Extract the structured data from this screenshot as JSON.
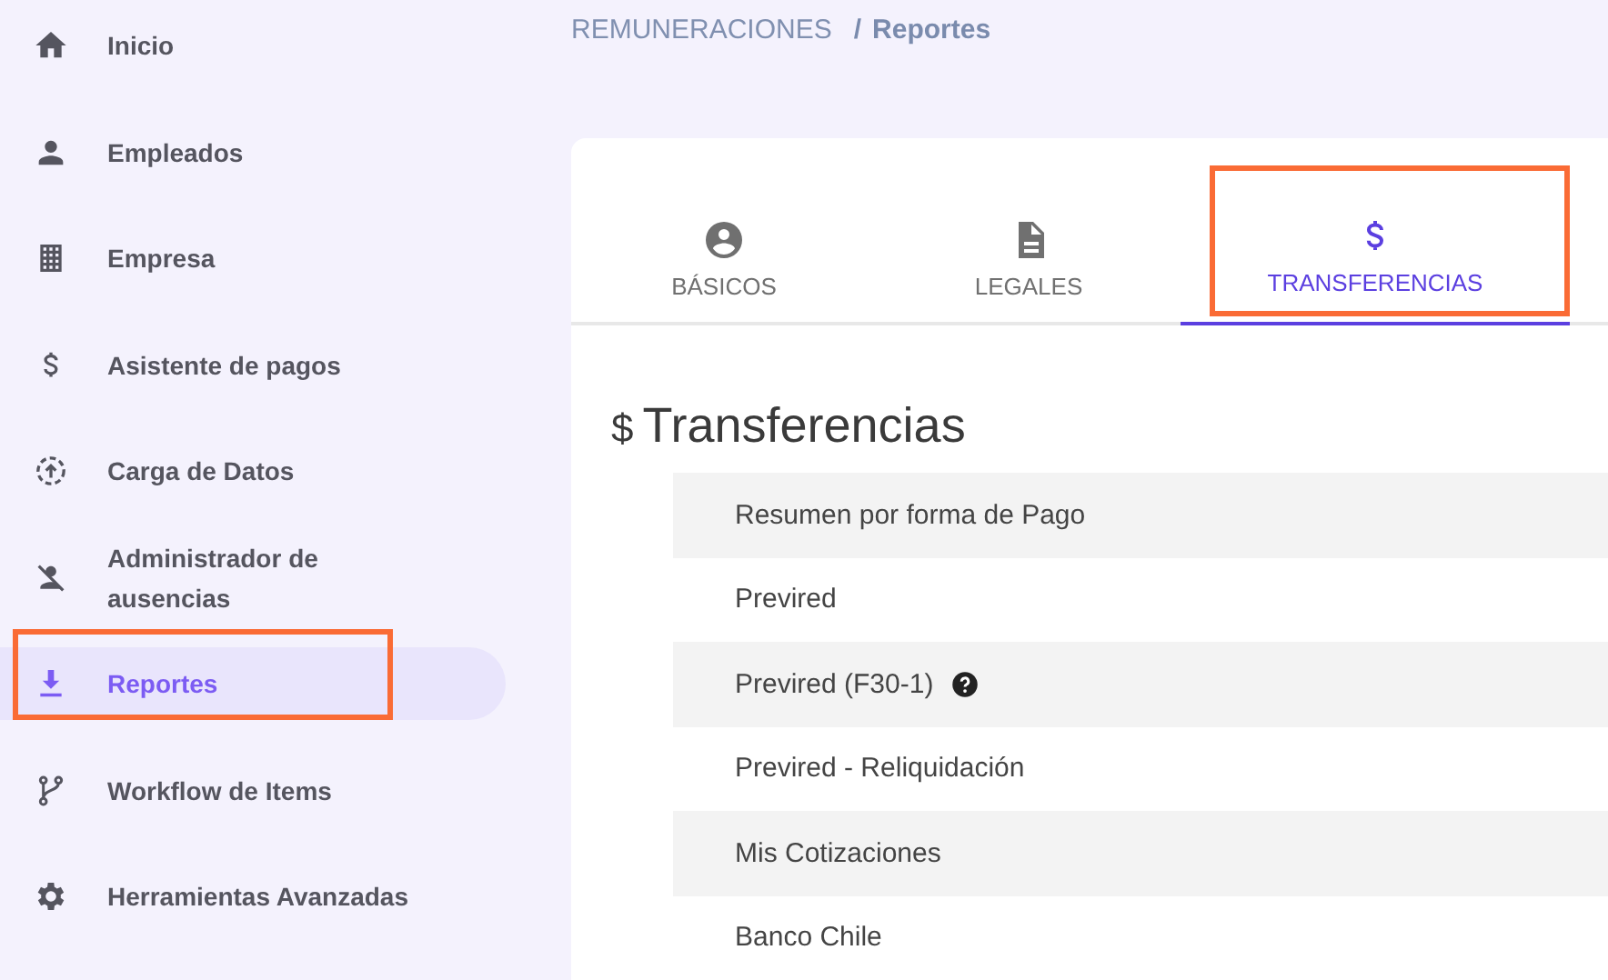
{
  "sidebar": {
    "items": [
      {
        "label": "Inicio",
        "selected": false,
        "highlighted": false
      },
      {
        "label": "Empleados",
        "selected": false,
        "highlighted": false
      },
      {
        "label": "Empresa",
        "selected": false,
        "highlighted": false
      },
      {
        "label": "Asistente de pagos",
        "selected": false,
        "highlighted": false
      },
      {
        "label": "Carga de Datos",
        "selected": false,
        "highlighted": false
      },
      {
        "label": "Administrador de ausencias",
        "selected": false,
        "highlighted": false
      },
      {
        "label": "Reportes",
        "selected": true,
        "highlighted": true
      },
      {
        "label": "Workflow de Items",
        "selected": false,
        "highlighted": false
      },
      {
        "label": "Herramientas Avanzadas",
        "selected": false,
        "highlighted": false
      }
    ]
  },
  "breadcrumb": {
    "parent": "REMUNERACIONES",
    "separator": "/",
    "current": "Reportes"
  },
  "tabs": [
    {
      "label": "BÁSICOS",
      "selected": false,
      "highlighted": false
    },
    {
      "label": "LEGALES",
      "selected": false,
      "highlighted": false
    },
    {
      "label": "TRANSFERENCIAS",
      "selected": true,
      "highlighted": true
    }
  ],
  "section": {
    "icon": "$",
    "title": "Transferencias"
  },
  "reports": [
    {
      "label": "Resumen por forma de Pago",
      "help": false
    },
    {
      "label": "Previred",
      "help": false
    },
    {
      "label": "Previred (F30-1)",
      "help": true
    },
    {
      "label": "Previred - Reliquidación",
      "help": false
    },
    {
      "label": "Mis Cotizaciones",
      "help": false
    },
    {
      "label": "Banco Chile",
      "help": false
    }
  ]
}
